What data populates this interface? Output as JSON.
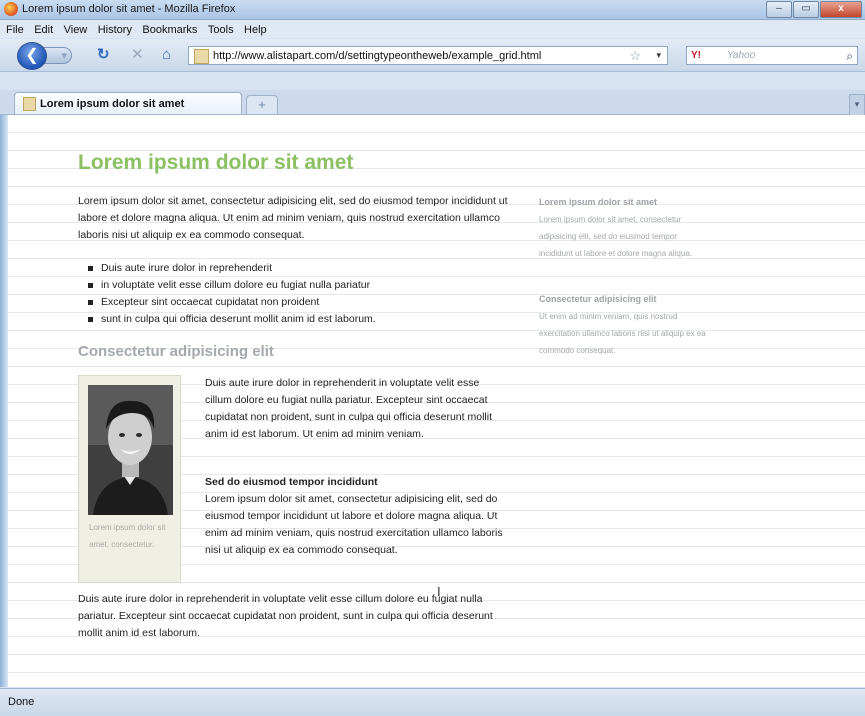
{
  "window": {
    "title": "Lorem ipsum dolor sit amet - Mozilla Firefox",
    "buttons": {
      "minimize": "–",
      "maximize": "▭",
      "close": "x"
    }
  },
  "menu": [
    "File",
    "Edit",
    "View",
    "History",
    "Bookmarks",
    "Tools",
    "Help"
  ],
  "nav": {
    "url": "http://www.alistapart.com/d/settingtypeontheweb/example_grid.html",
    "search_placeholder": "Yahoo",
    "search_engine": "Y!"
  },
  "tabs": [
    {
      "label": "Lorem ipsum dolor sit amet"
    }
  ],
  "page": {
    "heading": "Lorem ipsum dolor sit amet",
    "intro": "Lorem ipsum dolor sit amet, consectetur adipisicing elit, sed do eiusmod tempor incididunt ut labore et dolore magna aliqua. Ut enim ad minim veniam, quis nostrud exercitation ullamco laboris nisi ut aliquip ex ea commodo consequat.",
    "list": [
      "Duis aute irure dolor in reprehenderit",
      "in voluptate velit esse cillum dolore eu fugiat nulla pariatur",
      "Excepteur sint occaecat cupidatat non proident",
      "sunt in culpa qui officia deserunt mollit anim id est laborum."
    ],
    "subheading": "Consectetur adipisicing elit",
    "figure_caption": "Lorem ipsum dolor sit amet, consectetur.",
    "figure_text": "Duis aute irure dolor in reprehenderit in voluptate velit esse cillum dolore eu fugiat nulla pariatur. Excepteur sint occaecat cupidatat non proident, sunt in culpa qui officia deserunt mollit anim id est laborum. Ut enim ad minim veniam.",
    "minor_heading": "Sed do eiusmod tempor incididunt",
    "minor_text": "Lorem ipsum dolor sit amet, consectetur adipisicing elit, sed do eiusmod tempor incididunt ut labore et dolore magna aliqua. Ut enim ad minim veniam, quis nostrud exercitation ullamco laboris nisi ut aliquip ex ea commodo consequat.",
    "outro": "Duis aute irure dolor in reprehenderit in voluptate velit esse cillum dolore eu fugiat nulla pariatur. Excepteur sint occaecat cupidatat non proident, sunt in culpa qui officia deserunt mollit anim id est laborum."
  },
  "sidebar": [
    {
      "heading": "Lorem ipsum dolor sit amet",
      "text": "Lorem ipsum dolor sit amet, consectetur adipisicing elit, sed do eiusmod tempor incididunt ut labore et dolore magna aliqua."
    },
    {
      "heading": "Consectetur adipisicing elit",
      "text": "Ut enim ad minim veniam, quis nostrud exercitation ullamco laboris nisi ut aliquip ex ea commodo consequat."
    }
  ],
  "status": "Done",
  "colors": {
    "heading": "#8bc063",
    "subheading": "#a5a9ae",
    "aside": "#a4a7ab"
  }
}
